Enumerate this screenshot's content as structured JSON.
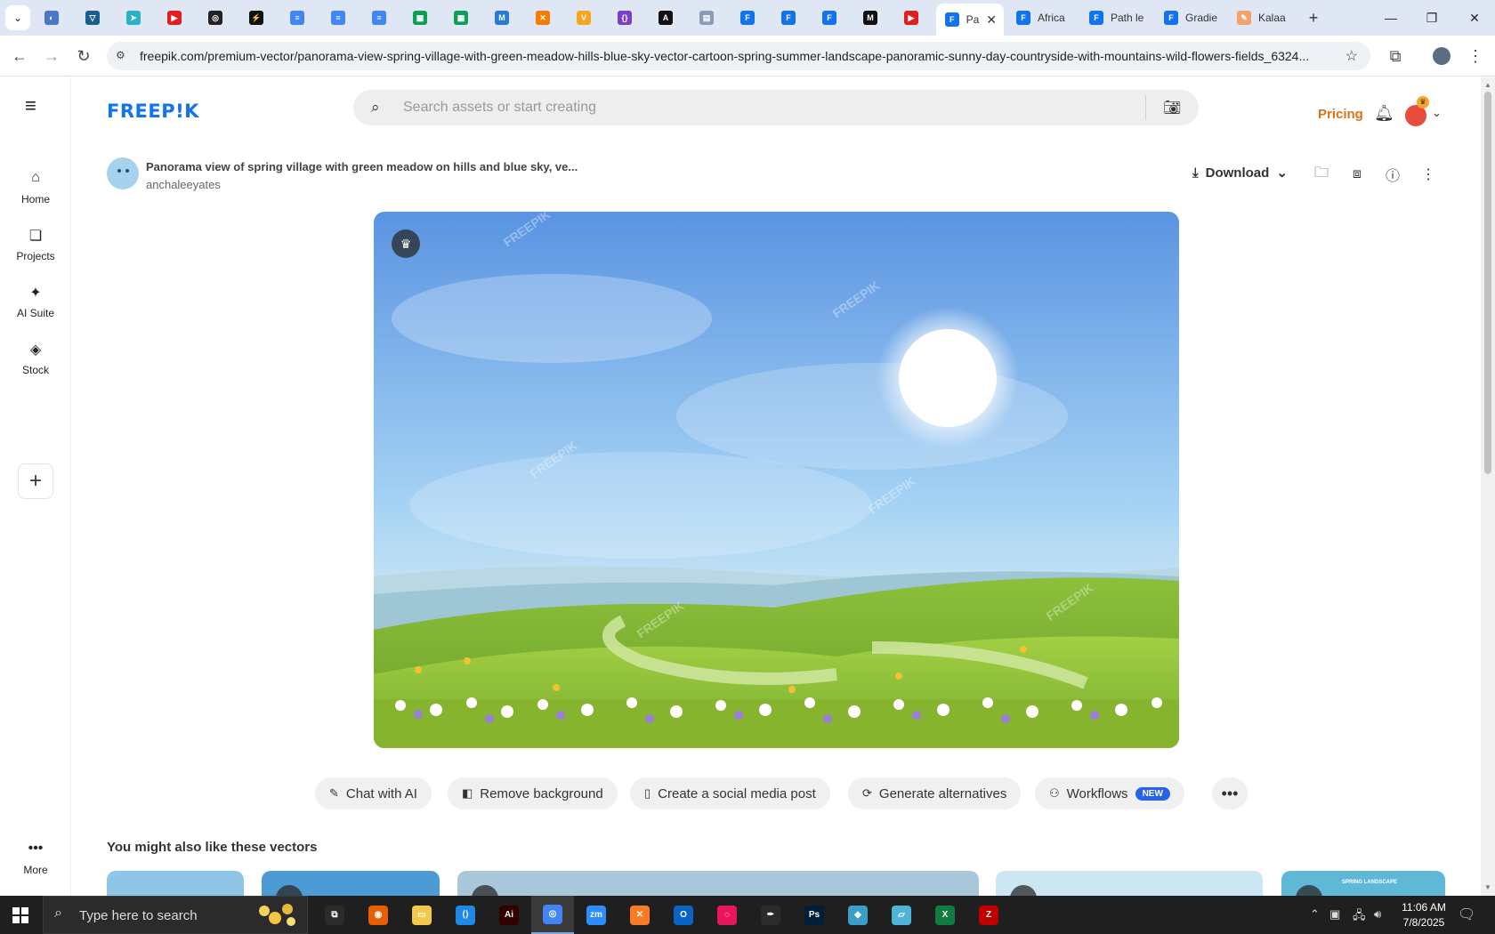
{
  "browser": {
    "pinned_tabs": [
      {
        "icon": "globe-icon",
        "color": "#4a78c8"
      },
      {
        "icon": "vpn-icon",
        "color": "#1b5e8c"
      },
      {
        "icon": "arrow-icon",
        "color": "#2bb0c8"
      },
      {
        "icon": "youtube-icon",
        "color": "#e02020"
      },
      {
        "icon": "target-icon",
        "color": "#222222"
      },
      {
        "icon": "bolt-icon",
        "color": "#111111"
      },
      {
        "icon": "docs-icon",
        "color": "#4285f4"
      },
      {
        "icon": "docs-icon",
        "color": "#4285f4"
      },
      {
        "icon": "docs-icon",
        "color": "#4285f4"
      },
      {
        "icon": "sheets-icon",
        "color": "#0f9d58"
      },
      {
        "icon": "sheets-icon",
        "color": "#0f9d58"
      },
      {
        "icon": "ms-icon",
        "color": "#2b7bd6"
      },
      {
        "icon": "xampp-icon",
        "color": "#f57c00"
      },
      {
        "icon": "v-icon",
        "color": "#f5a623"
      },
      {
        "icon": "brace-icon",
        "color": "#7b3fc7"
      },
      {
        "icon": "a-icon",
        "color": "#111111"
      },
      {
        "icon": "grid-icon",
        "color": "#8a9bb8"
      },
      {
        "icon": "freepik-icon",
        "color": "#1273eb"
      },
      {
        "icon": "freepik-icon",
        "color": "#1273eb"
      },
      {
        "icon": "freepik-icon",
        "color": "#1273eb"
      },
      {
        "icon": "m-icon",
        "color": "#111111"
      },
      {
        "icon": "youtube-icon",
        "color": "#e02020"
      }
    ],
    "tabs": [
      {
        "label": "Pa",
        "active": true,
        "close": "✕"
      },
      {
        "label": "Africa",
        "active": false
      },
      {
        "label": "Path le",
        "active": false
      },
      {
        "label": "Gradie",
        "active": false
      },
      {
        "label": "Kalaa",
        "active": false
      }
    ],
    "url": "freepik.com/premium-vector/panorama-view-spring-village-with-green-meadow-hills-blue-sky-vector-cartoon-spring-summer-landscape-panoramic-sunny-day-countryside-with-mountains-wild-flowers-fields_6324..."
  },
  "header": {
    "logo": "FREEP!K",
    "search_placeholder": "Search assets or start creating",
    "pricing": "Pricing"
  },
  "sidenav": {
    "items": [
      {
        "label": "Home",
        "icon": "home-icon"
      },
      {
        "label": "Projects",
        "icon": "projects-icon"
      },
      {
        "label": "AI Suite",
        "icon": "sparkle-icon"
      },
      {
        "label": "Stock",
        "icon": "stock-icon"
      }
    ],
    "more": "More"
  },
  "asset": {
    "title": "Panorama view of spring village with green meadow on hills and blue sky, ve...",
    "author": "anchaleeyates",
    "download": "Download",
    "watermark": "FREEPIK"
  },
  "ai_actions": [
    {
      "label": "Chat with AI",
      "icon": "chat-icon"
    },
    {
      "label": "Remove background",
      "icon": "remove-bg-icon"
    },
    {
      "label": "Create a social media post",
      "icon": "phone-icon"
    },
    {
      "label": "Generate alternatives",
      "icon": "refresh-icon"
    },
    {
      "label": "Workflows",
      "icon": "workflow-icon",
      "badge": "NEW"
    }
  ],
  "related": {
    "heading": "You might also like these vectors",
    "thumb_caption": "SPRING LANDSCAPE"
  },
  "taskbar": {
    "search_placeholder": "Type here to search",
    "apps": [
      "task-view",
      "firefox",
      "file-explorer",
      "vscode",
      "illustrator",
      "chrome",
      "zoom",
      "xampp",
      "outlook",
      "creative-cloud",
      "inkscape",
      "photoshop",
      "app",
      "notepad",
      "excel",
      "filezilla"
    ],
    "time": "11:06 AM",
    "date": "7/8/2025"
  },
  "colors": {
    "brand": "#1273eb",
    "pricing": "#e07012",
    "new_badge": "#2563eb"
  }
}
